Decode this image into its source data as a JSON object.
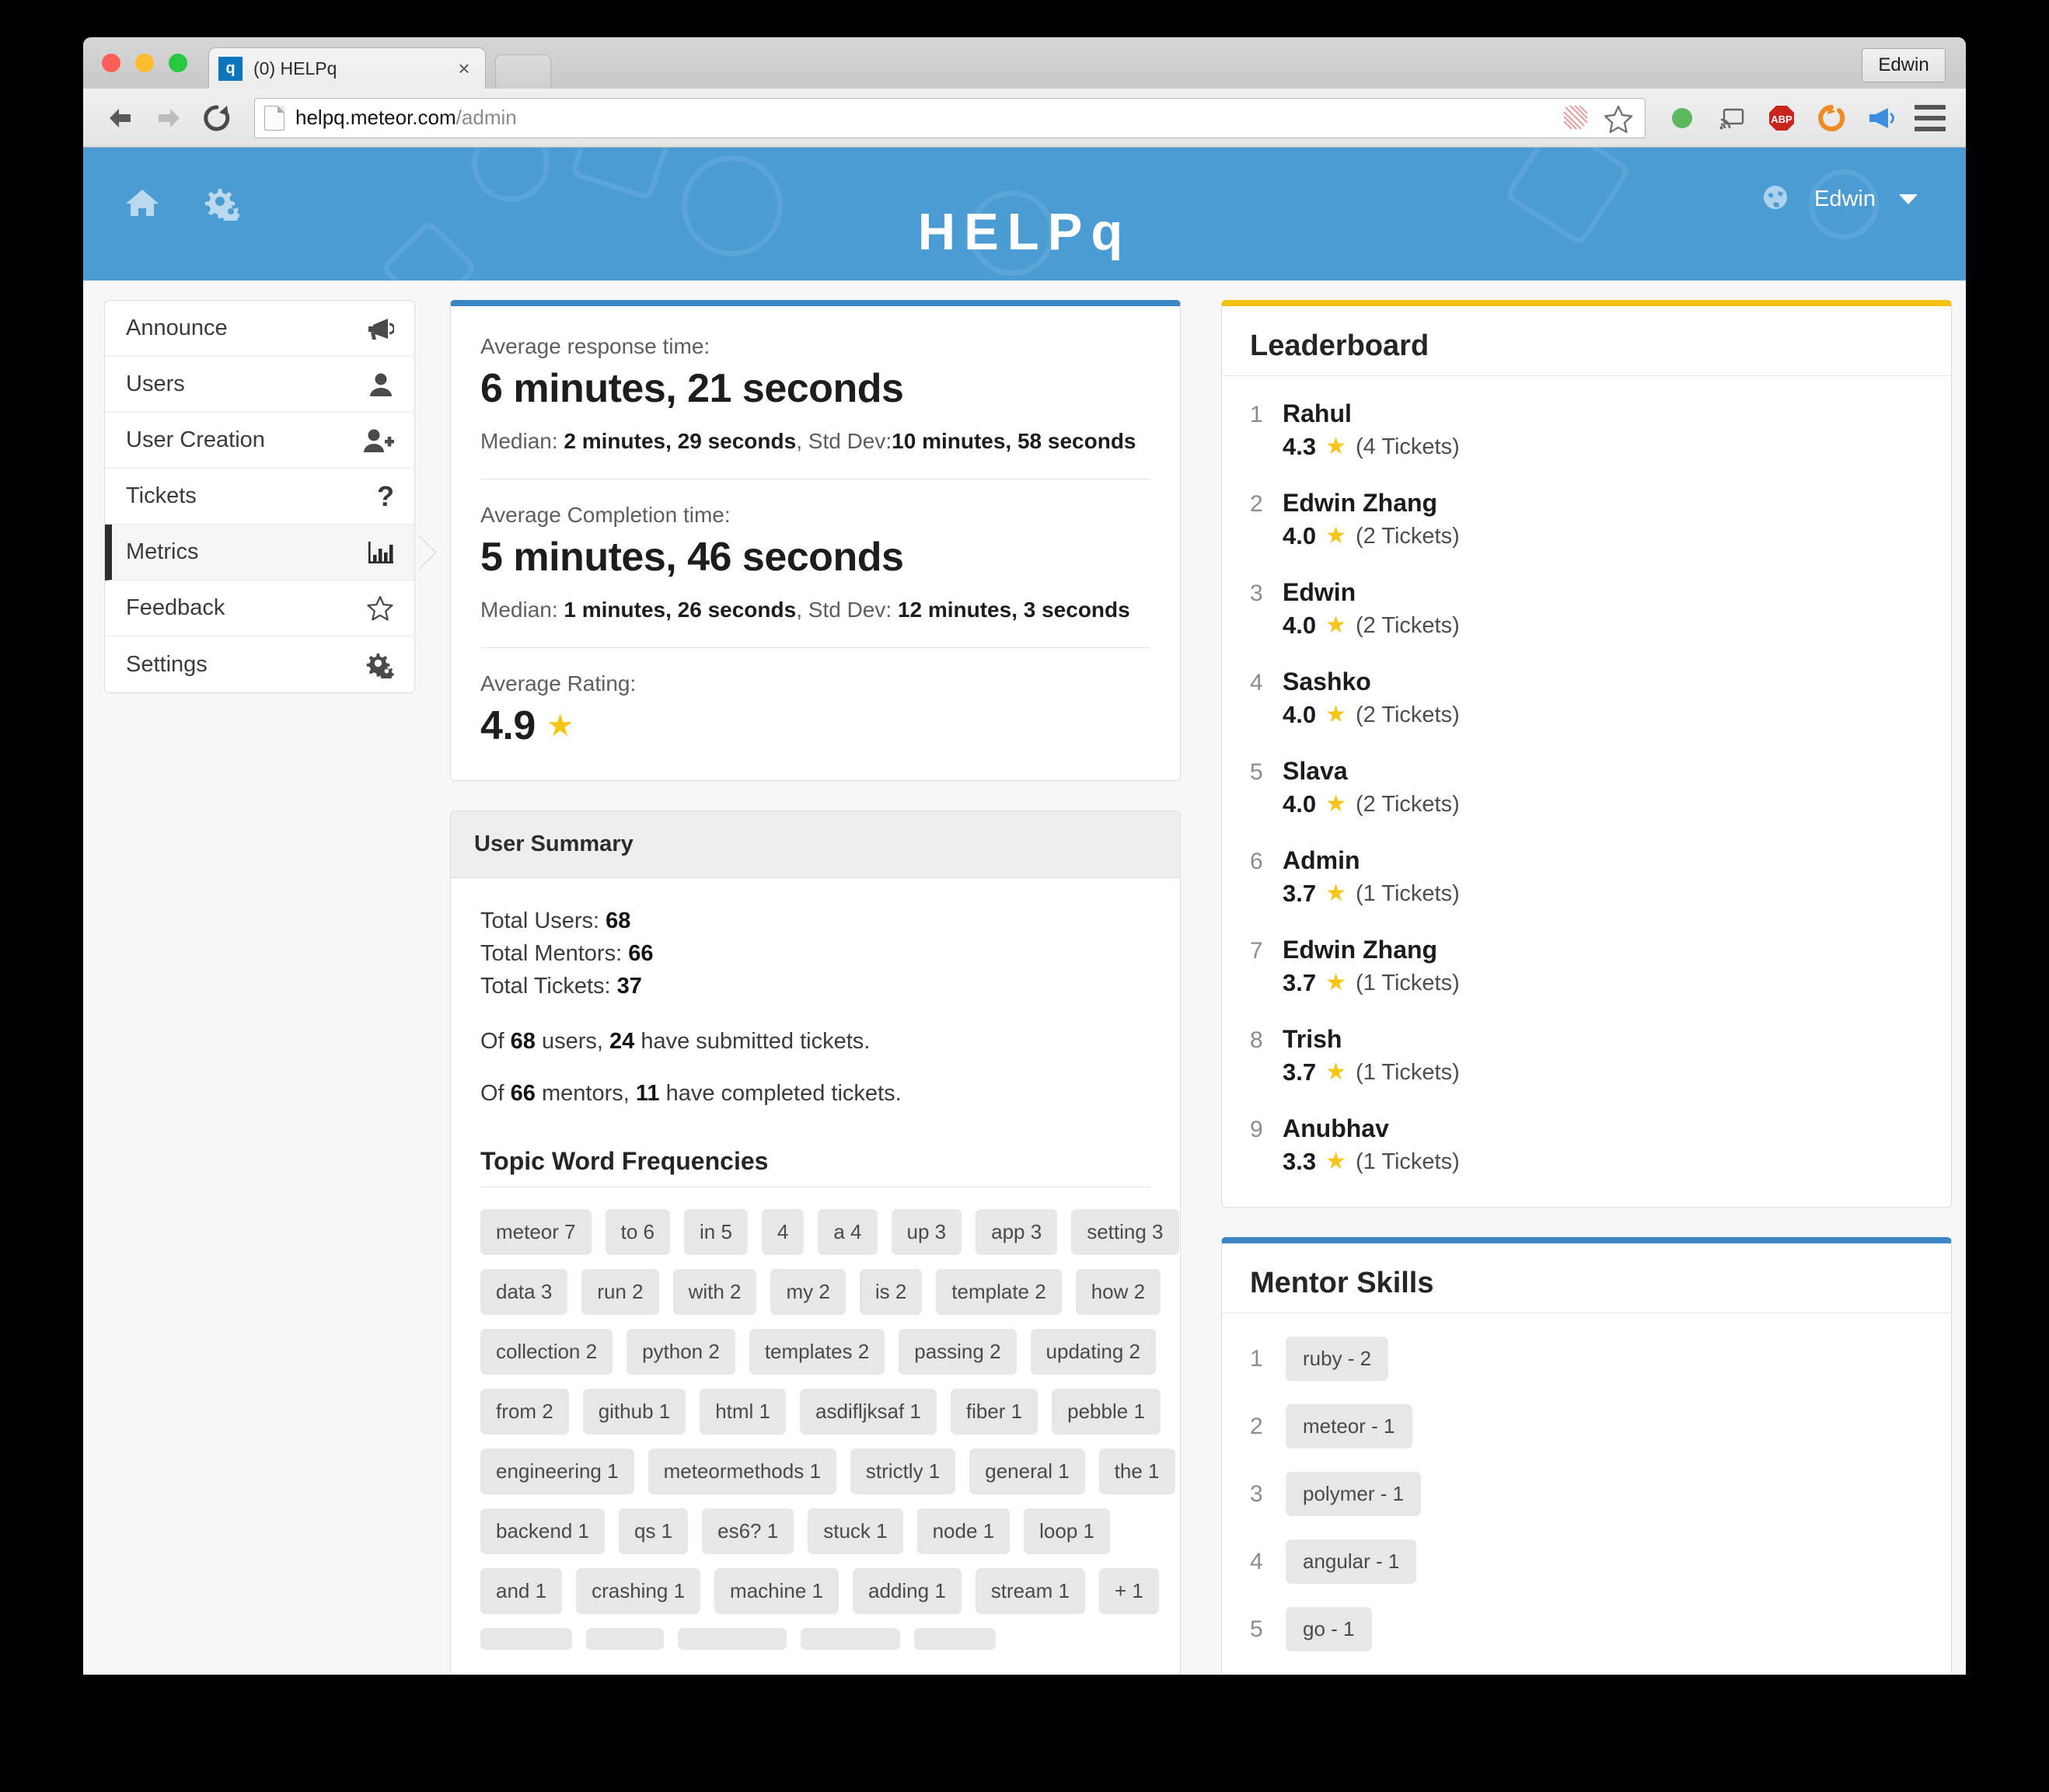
{
  "browser": {
    "tab": {
      "favicon_letter": "q",
      "title": "(0) HELPq",
      "close_label": "×"
    },
    "profile_label": "Edwin",
    "url_host": "helpq.meteor.com",
    "url_path": "/admin",
    "back_icon": "back-arrow-icon",
    "forward_icon": "forward-arrow-icon",
    "reload_icon": "reload-icon",
    "extensions": [
      "green-dot-icon",
      "cast-icon",
      "adblock-plus-icon",
      "orange-circle-icon",
      "blue-megaphone-icon"
    ]
  },
  "app_header": {
    "brand": "HELPq",
    "home_icon": "home-icon",
    "gears_icon": "gears-icon",
    "globe_icon": "globe-icon",
    "user_label": "Edwin",
    "accent_blue": "#4a9cd3"
  },
  "sidebar": {
    "items": [
      {
        "label": "Announce",
        "icon": "megaphone-icon",
        "active": false
      },
      {
        "label": "Users",
        "icon": "user-icon",
        "active": false
      },
      {
        "label": "User Creation",
        "icon": "user-plus-icon",
        "active": false
      },
      {
        "label": "Tickets",
        "icon": "question-mark-icon",
        "active": false
      },
      {
        "label": "Metrics",
        "icon": "bar-chart-icon",
        "active": true
      },
      {
        "label": "Feedback",
        "icon": "star-outline-icon",
        "active": false
      },
      {
        "label": "Settings",
        "icon": "gears-icon",
        "active": false
      }
    ]
  },
  "metrics": {
    "response": {
      "label": "Average response time:",
      "value": "6 minutes, 21 seconds",
      "median_label": "Median: ",
      "median_value": "2 minutes, 29 seconds",
      "stddev_label": ", Std Dev:",
      "stddev_value": "10 minutes, 58 seconds"
    },
    "completion": {
      "label": "Average Completion time:",
      "value": "5 minutes, 46 seconds",
      "median_label": "Median: ",
      "median_value": "1 minutes, 26 seconds",
      "stddev_label": ", Std Dev: ",
      "stddev_value": "12 minutes, 3 seconds"
    },
    "rating": {
      "label": "Average Rating:",
      "value": "4.9",
      "star": "★"
    }
  },
  "user_summary": {
    "heading": "User Summary",
    "total_users_label": "Total Users: ",
    "total_users": "68",
    "total_mentors_label": "Total Mentors: ",
    "total_mentors": "66",
    "total_tickets_label": "Total Tickets: ",
    "total_tickets": "37",
    "submitted_prefix": "Of ",
    "submitted_users": "68",
    "submitted_mid": " users, ",
    "submitted_count": "24",
    "submitted_suffix": " have submitted tickets.",
    "completed_prefix": "Of ",
    "completed_mentors": "66",
    "completed_mid": " mentors, ",
    "completed_count": "11",
    "completed_suffix": " have completed tickets."
  },
  "topic_words": {
    "heading": "Topic Word Frequencies",
    "rows": [
      [
        "meteor 7",
        "to 6",
        "in 5",
        "4",
        "a 4",
        "up 3",
        "app 3",
        "setting 3"
      ],
      [
        "data 3",
        "run 2",
        "with 2",
        "my 2",
        "is 2",
        "template 2",
        "how 2"
      ],
      [
        "collection 2",
        "python 2",
        "templates 2",
        "passing 2",
        "updating 2"
      ],
      [
        "from 2",
        "github 1",
        "html 1",
        "asdifljksaf 1",
        "fiber 1",
        "pebble 1"
      ],
      [
        "engineering 1",
        "meteormethods 1",
        "strictly 1",
        "general 1",
        "the 1"
      ],
      [
        "backend 1",
        "qs 1",
        "es6? 1",
        "stuck 1",
        "node 1",
        "loop 1"
      ],
      [
        "and 1",
        "crashing 1",
        "machine 1",
        "adding 1",
        "stream 1",
        "+ 1"
      ],
      [
        "",
        "",
        "",
        "",
        ""
      ]
    ]
  },
  "leaderboard": {
    "heading": "Leaderboard",
    "accent": "#f5c211",
    "star": "★",
    "entries": [
      {
        "rank": "1",
        "name": "Rahul",
        "score": "4.3",
        "tickets": "(4 Tickets)"
      },
      {
        "rank": "2",
        "name": "Edwin Zhang",
        "score": "4.0",
        "tickets": "(2 Tickets)"
      },
      {
        "rank": "3",
        "name": "Edwin",
        "score": "4.0",
        "tickets": "(2 Tickets)"
      },
      {
        "rank": "4",
        "name": "Sashko",
        "score": "4.0",
        "tickets": "(2 Tickets)"
      },
      {
        "rank": "5",
        "name": "Slava",
        "score": "4.0",
        "tickets": "(2 Tickets)"
      },
      {
        "rank": "6",
        "name": "Admin",
        "score": "3.7",
        "tickets": "(1 Tickets)"
      },
      {
        "rank": "7",
        "name": "Edwin Zhang",
        "score": "3.7",
        "tickets": "(1 Tickets)"
      },
      {
        "rank": "8",
        "name": "Trish",
        "score": "3.7",
        "tickets": "(1 Tickets)"
      },
      {
        "rank": "9",
        "name": "Anubhav",
        "score": "3.3",
        "tickets": "(1 Tickets)"
      }
    ]
  },
  "mentor_skills": {
    "heading": "Mentor Skills",
    "accent": "#3b87c4",
    "entries": [
      {
        "rank": "1",
        "label": "ruby - 2"
      },
      {
        "rank": "2",
        "label": "meteor - 1"
      },
      {
        "rank": "3",
        "label": "polymer - 1"
      },
      {
        "rank": "4",
        "label": "angular - 1"
      },
      {
        "rank": "5",
        "label": "go - 1"
      }
    ]
  }
}
